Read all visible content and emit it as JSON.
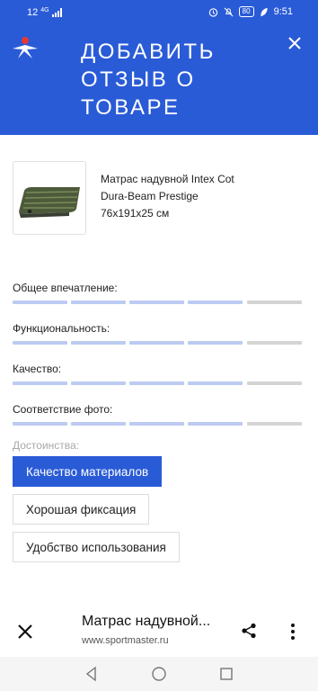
{
  "status": {
    "network": "12",
    "network_sup": "4G",
    "battery": "80",
    "time": "9:51"
  },
  "header": {
    "title": "ДОБАВИТЬ ОТЗЫВ О ТОВАРЕ",
    "close_icon": "close-icon",
    "accent_color": "#2a5bd7"
  },
  "product": {
    "name": "Матрас надувной Intex Cot Dura-Beam Prestige 76x191x25 см"
  },
  "ratings": [
    {
      "label": "Общее впечатление:",
      "filled": 4,
      "total": 5
    },
    {
      "label": "Функциональность:",
      "filled": 4,
      "total": 5
    },
    {
      "label": "Качество:",
      "filled": 4,
      "total": 5
    },
    {
      "label": "Соответствие фото:",
      "filled": 4,
      "total": 5
    }
  ],
  "advantages": {
    "label": "Достоинства:",
    "chips": [
      {
        "label": "Качество материалов",
        "selected": true
      },
      {
        "label": "Хорошая фиксация",
        "selected": false
      },
      {
        "label": "Удобство использования",
        "selected": false
      }
    ]
  },
  "tab": {
    "title": "Матрас надувной...",
    "url": "www.sportmaster.ru"
  },
  "colors": {
    "bar_filled": "#bccbf2",
    "bar_empty": "#d4d4d4"
  }
}
